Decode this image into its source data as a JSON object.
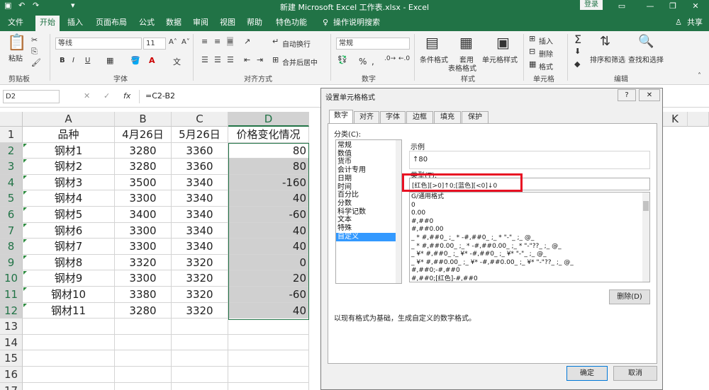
{
  "window": {
    "title": "新建 Microsoft Excel 工作表.xlsx - Excel",
    "login": "登录",
    "share": "共享",
    "undo_glyph": "↶",
    "redo_glyph": "↷",
    "save_glyph": "▣",
    "qa_more_glyph": "▾"
  },
  "tabs": [
    "文件",
    "开始",
    "插入",
    "页面布局",
    "公式",
    "数据",
    "审阅",
    "视图",
    "帮助",
    "特色功能"
  ],
  "tell_me": "操作说明搜索",
  "ribbon": {
    "paste": "粘贴",
    "clipboard": "剪贴板",
    "font_name": "等线",
    "font_size": "11",
    "font_group": "字体",
    "bold": "B",
    "italic": "I",
    "underline": "U",
    "grow_font": "A˄",
    "shrink_font": "A˅",
    "wrap": "自动换行",
    "merge": "合并后居中",
    "align_group": "对齐方式",
    "num_format": "常规",
    "percent": "%",
    "comma": ",",
    "number_group": "数字",
    "cond_format": "条件格式",
    "table_format_1": "套用",
    "table_format_2": "表格格式",
    "cell_style": "单元格样式",
    "style_group": "样式",
    "insert": "插入",
    "delete": "删除",
    "format": "格式",
    "cells_group": "单元格",
    "sum_glyph": "Σ",
    "sort": "排序和筛选",
    "find": "查找和选择",
    "edit_group": "编辑"
  },
  "formula_bar": {
    "name_box": "D2",
    "fx": "fx",
    "cancel": "✕",
    "enter": "✓",
    "formula": "=C2-B2"
  },
  "sheet": {
    "columns": [
      "A",
      "B",
      "C",
      "D"
    ],
    "extra_col": "K",
    "row_numbers": [
      "1",
      "2",
      "3",
      "4",
      "5",
      "6",
      "7",
      "8",
      "9",
      "10",
      "11",
      "12",
      "13",
      "14",
      "15",
      "16",
      "17"
    ],
    "header": [
      "品种",
      "4月26日",
      "5月26日",
      "价格变化情况"
    ],
    "rows": [
      [
        "钢材1",
        "3280",
        "3360",
        "80"
      ],
      [
        "钢材2",
        "3280",
        "3360",
        "80"
      ],
      [
        "钢材3",
        "3500",
        "3340",
        "-160"
      ],
      [
        "钢材4",
        "3300",
        "3340",
        "40"
      ],
      [
        "钢材5",
        "3400",
        "3340",
        "-60"
      ],
      [
        "钢材6",
        "3300",
        "3340",
        "40"
      ],
      [
        "钢材7",
        "3300",
        "3340",
        "40"
      ],
      [
        "钢材8",
        "3320",
        "3320",
        "0"
      ],
      [
        "钢材9",
        "3300",
        "3320",
        "20"
      ],
      [
        "钢材10",
        "3380",
        "3320",
        "-60"
      ],
      [
        "钢材11",
        "3280",
        "3320",
        "40"
      ]
    ]
  },
  "dialog": {
    "title": "设置单元格格式",
    "help": "?",
    "close": "✕",
    "tabs": [
      "数字",
      "对齐",
      "字体",
      "边框",
      "填充",
      "保护"
    ],
    "category_label": "分类(C):",
    "categories": [
      "常规",
      "数值",
      "货币",
      "会计专用",
      "日期",
      "时间",
      "百分比",
      "分数",
      "科学记数",
      "文本",
      "特殊",
      "自定义"
    ],
    "sample_label": "示例",
    "sample_value": "↑80",
    "type_label": "类型(T):",
    "type_value": "[红色][>0]↑0;[蓝色][<0]↓0",
    "format_list": [
      "G/通用格式",
      "0",
      "0.00",
      "#,##0",
      "#,##0.00",
      "_ * #,##0_ ;_ * -#,##0_ ;_ * \"-\"_ ;_ @_",
      "_ * #,##0.00_ ;_ * -#,##0.00_ ;_ * \"-\"??_ ;_ @_",
      "_ ¥* #,##0_ ;_ ¥* -#,##0_ ;_ ¥* \"-\"_ ;_ @_",
      "_ ¥* #,##0.00_ ;_ ¥* -#,##0.00_ ;_ ¥* \"-\"??_ ;_ @_",
      "#,##0;-#,##0",
      "#,##0;[红色]-#,##0"
    ],
    "delete_btn": "删除(D)",
    "description": "以现有格式为基础，生成自定义的数字格式。",
    "ok": "确定",
    "cancel": "取消"
  },
  "colors": {
    "excel_green": "#217346",
    "highlight_red": "#e81123",
    "selection_gray": "#d0d0d0"
  }
}
